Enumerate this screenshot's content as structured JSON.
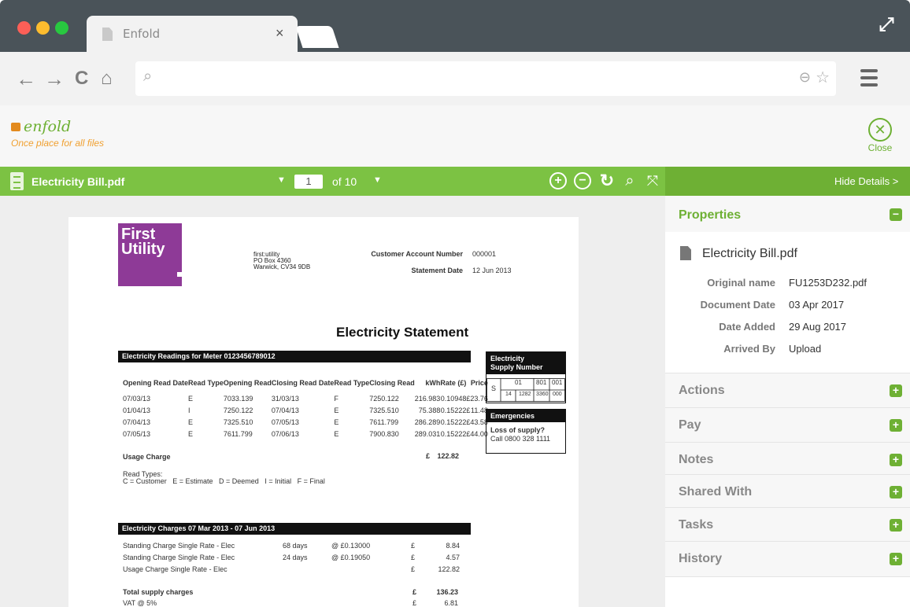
{
  "browser": {
    "tab_title": "Enfold",
    "tab_close": "×"
  },
  "app": {
    "logo_text": "enfold",
    "tagline": "Once place for all files",
    "close_label": "Close"
  },
  "toolbar": {
    "document_name": "Electricity Bill.pdf",
    "page_current": "1",
    "page_of": "of 10",
    "hide_details": "Hide Details >"
  },
  "document": {
    "logo_line1": "First",
    "logo_line2": "Utility",
    "address": [
      "first:utility",
      "PO Box 4360",
      "Warwick, CV34 9DB"
    ],
    "account_label": "Customer Account Number",
    "account_value": "000001",
    "statement_date_label": "Statement Date",
    "statement_date_value": "12 Jun 2013",
    "title": "Electricity Statement",
    "readings_header": "Electricity Readings for Meter 0123456789012",
    "readings_columns": [
      "Opening Read Date",
      "Read Type",
      "Opening Read",
      "Closing Read Date",
      "Read Type",
      "Closing Read",
      "kWh",
      "Rate (£)",
      "Price"
    ],
    "readings_rows": [
      [
        "07/03/13",
        "E",
        "7033.139",
        "31/03/13",
        "F",
        "7250.122",
        "216.983",
        "0.10948",
        "£",
        "23.76"
      ],
      [
        "01/04/13",
        "I",
        "7250.122",
        "07/04/13",
        "E",
        "7325.510",
        "75.388",
        "0.15222",
        "£",
        "11.48"
      ],
      [
        "07/04/13",
        "E",
        "7325.510",
        "07/05/13",
        "E",
        "7611.799",
        "286.289",
        "0.15222",
        "£",
        "43.58"
      ],
      [
        "07/05/13",
        "E",
        "7611.799",
        "07/06/13",
        "E",
        "7900.830",
        "289.031",
        "0.15222",
        "£",
        "44.00"
      ]
    ],
    "usage_label": "Usage Charge",
    "usage_currency": "£",
    "usage_value": "122.82",
    "read_types_label": "Read Types:",
    "read_types": "C = Customer   E = Estimate   D = Deemed   I = Initial   F = Final",
    "supply_header_1": "Electricity",
    "supply_header_2": "Supply Number",
    "supply_s": "S",
    "supply_row1": [
      "01",
      "801",
      "001"
    ],
    "supply_row2": [
      "14",
      "1282",
      "3360",
      "000"
    ],
    "emergency_header": "Emergencies",
    "emergency_bold": "Loss of supply?",
    "emergency_phone": "Call 0800 328 1111",
    "charges_header": "Electricity Charges 07 Mar 2013 - 07 Jun 2013",
    "charges_rows": [
      [
        "Standing Charge Single Rate - Elec",
        "68 days",
        "@ £0.13000",
        "£",
        "8.84"
      ],
      [
        "Standing Charge Single Rate - Elec",
        "24 days",
        "@ £0.19050",
        "£",
        "4.57"
      ],
      [
        "Usage Charge Single Rate - Elec",
        "",
        "",
        "£",
        "122.82"
      ]
    ],
    "total_label": "Total supply charges",
    "total_currency": "£",
    "total_value": "136.23",
    "vat_label": "VAT @ 5%",
    "vat_currency": "£",
    "vat_value": "6.81"
  },
  "properties": {
    "title": "Properties",
    "file_name": "Electricity Bill.pdf",
    "fields": [
      {
        "label": "Original name",
        "value": "FU1253D232.pdf"
      },
      {
        "label": "Document Date",
        "value": "03 Apr 2017"
      },
      {
        "label": "Date Added",
        "value": "29 Aug 2017"
      },
      {
        "label": "Arrived By",
        "value": "Upload"
      }
    ]
  },
  "sections": [
    "Actions",
    "Pay",
    "Notes",
    "Shared With",
    "Tasks",
    "History"
  ],
  "colors": {
    "accent_green": "#7cc243",
    "dark_green": "#6eb034",
    "brand_purple": "#8e3a97",
    "chrome_dark": "#4a5359"
  }
}
